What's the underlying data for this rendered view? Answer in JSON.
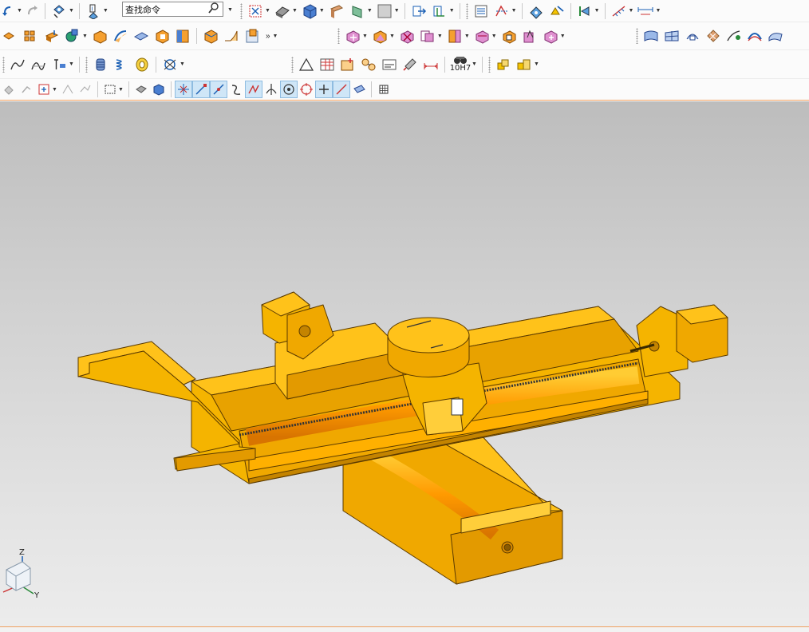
{
  "search": {
    "placeholder": "查找命令",
    "value": "查找命令"
  },
  "toolbars": {
    "row1": [
      "undo-icon",
      "redo-icon",
      "snap-view-icon",
      "info-icon",
      "fit-view-icon",
      "shade-icon",
      "cube-icon",
      "section-icon",
      "ortho-view-icon",
      "color-swatch-icon",
      "move-icon",
      "wcs-icon",
      "layer-icon",
      "analysis-icon",
      "relation-icon",
      "dimension-icon"
    ],
    "row2": [
      "pattern-icon",
      "array-icon",
      "extrude-icon",
      "boolean-icon",
      "block-icon",
      "sweep-icon",
      "face-icon",
      "shell-icon",
      "hole-icon",
      "more-icon",
      "surface-icon",
      "trim-icon",
      "mesh-icon",
      "offset-icon"
    ],
    "row3": [
      "spline-icon",
      "curve-icon",
      "text-icon",
      "spring-icon",
      "coil-icon",
      "gear-icon",
      "tolerance-icon",
      "triangle-icon",
      "table-icon",
      "note-icon",
      "datum-icon",
      "balloon-icon",
      "fit-label-icon",
      "assembly-icon"
    ],
    "row4": [
      "select-filter-icon",
      "selection-box-icon",
      "snap-point-icon",
      "snap-end-icon",
      "snap-mid-icon",
      "snap-curve-icon",
      "snap-center-icon",
      "snap-quadrant-icon",
      "snap-existing-icon",
      "grid-icon"
    ]
  },
  "fit_label": "10H7",
  "triad": {
    "z": "Z",
    "y": "Y"
  },
  "colors": {
    "accent": "#f0a060",
    "model": "#f5b400",
    "model_shadow": "#c88400",
    "viewport_top": "#bdbdbd",
    "viewport_bottom": "#ececec"
  }
}
